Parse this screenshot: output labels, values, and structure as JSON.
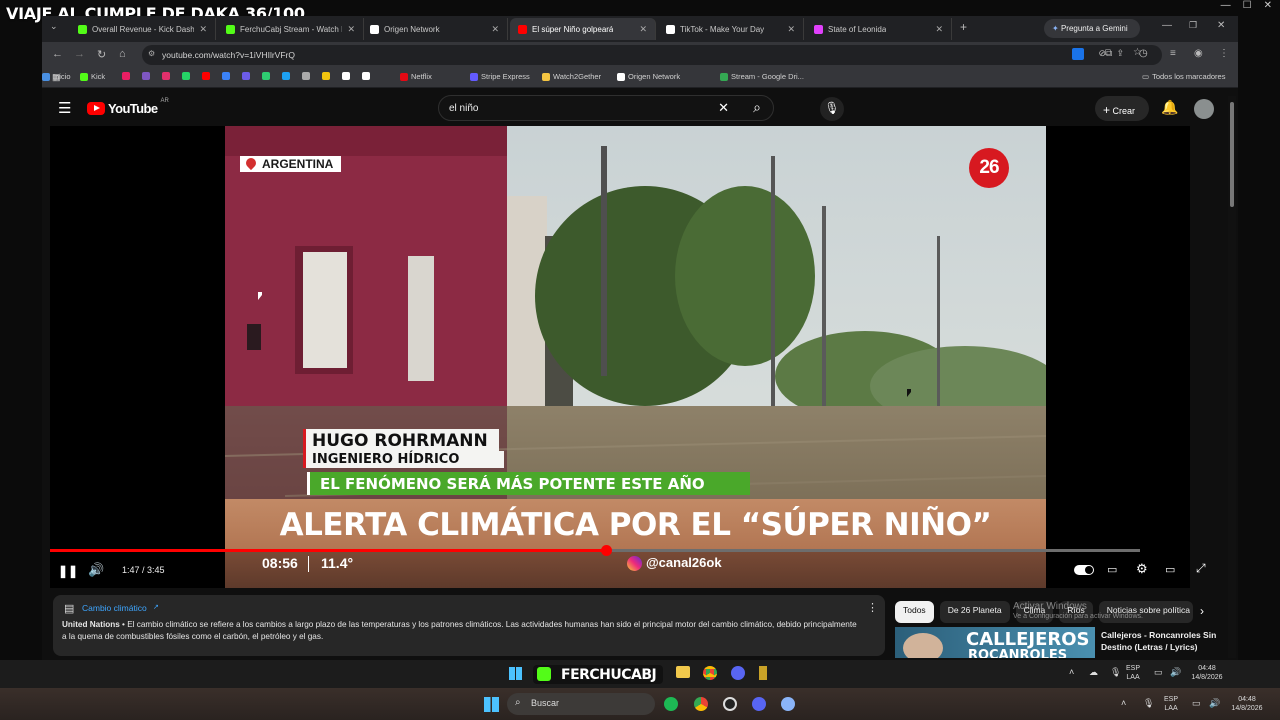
{
  "overlay": {
    "stream_title": "VIAJE AL CUMPLE DE DAKA 36/100"
  },
  "browser": {
    "tabs": [
      {
        "label": "Overall Revenue - Kick Dashbo",
        "color": "#53fc18"
      },
      {
        "label": "FerchuCabj Stream - Watch Liv",
        "color": "#53fc18"
      },
      {
        "label": "Origen Network",
        "color": "#ffffff"
      },
      {
        "label": "El súper Niño golpeará",
        "color": "#ff0000"
      },
      {
        "label": "TikTok - Make Your Day",
        "color": "#ffffff"
      },
      {
        "label": "State of Leonida",
        "color": "#e040fb"
      }
    ],
    "gemini_label": "Pregunta a Gemini",
    "url": "youtube.com/watch?v=1iVHIlrVFrQ",
    "bookmarks": [
      {
        "label": "Kick",
        "color": "#53fc18"
      },
      {
        "label": "Netflix",
        "color": "#e50914"
      },
      {
        "label": "Stripe Express",
        "color": "#635bff"
      },
      {
        "label": "Watch2Gether",
        "color": "#f5c542"
      },
      {
        "label": "Origen Network",
        "color": "#ffffff"
      },
      {
        "label": "Stream - Google Dri...",
        "color": "#34a853"
      },
      {
        "label": "Inicio",
        "color": "#4a90e2"
      }
    ],
    "all_bookmarks": "Todos los marcadores"
  },
  "youtube": {
    "logo": "YouTube",
    "region": "AR",
    "search_value": "el niño",
    "create_label": "Crear"
  },
  "video": {
    "location_tag": "ARGENTINA",
    "channel_logo": "26",
    "name": "HUGO ROHRMANN",
    "role": "INGENIERO HÍDRICO",
    "subtitle": "EL FENÓMENO SERÁ MÁS POTENTE ESTE AÑO",
    "headline": "ALERTA CLIMÁTICA POR EL “SÚPER NIÑO”",
    "clock": "08:56",
    "temperature": "11.4°",
    "handle": "@canal26ok",
    "corner_logo": "26",
    "progress_fraction": 0.51
  },
  "controls": {
    "time": "1:47 / 3:45"
  },
  "info_panel": {
    "topic": "Cambio climático",
    "source": "United Nations",
    "text": " • El cambio climático se refiere a los cambios a largo plazo de las temperaturas y los patrones climáticos. Las actividades humanas han sido el principal motor del cambio climático, debido principalmente a la quema de combustibles fósiles como el carbón, el petróleo y el gas."
  },
  "chips": [
    "Todos",
    "De 26 Planeta",
    "Clima",
    "Ríos",
    "Noticias sobre política"
  ],
  "windows_watermark": {
    "title": "Activar Windows",
    "sub": "Ve a Configuración para activar Windows."
  },
  "related": {
    "thumb_text_1": "CALLEJEROS",
    "thumb_text_2": "ROCANROLES",
    "title": "Callejeros - Roncanroles Sin Destino (Letras / Lyrics)"
  },
  "taskbar_inner": {
    "stream_logo": "FERCHUCABJ",
    "lang": "ESP",
    "lang2": "LAA",
    "time": "04:48",
    "date": "14/8/2026"
  },
  "taskbar_outer": {
    "search": "Buscar",
    "lang": "ESP",
    "lang2": "LAA",
    "time": "04:48",
    "date": "14/8/2026"
  }
}
